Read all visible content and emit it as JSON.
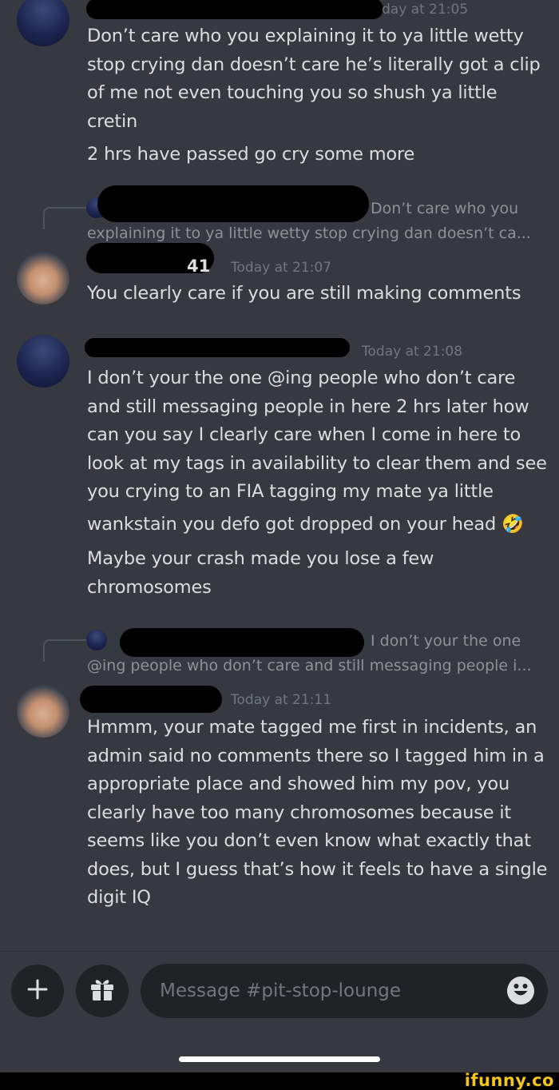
{
  "messages": [
    {
      "timestamp": "day at 21:05",
      "lines": [
        "Don’t care who you explaining it to ya little wetty",
        "stop crying dan doesn’t care he’s literally got a clip",
        "of me not even touching you so shush ya little",
        "cretin"
      ],
      "extra": [
        "2 hrs have passed go cry some more"
      ]
    },
    {
      "reply_preview_line1": "Don’t care who you",
      "reply_preview_line2": "explaining it to ya little wetty stop crying dan doesn’t ca...",
      "author_fragment": "41",
      "timestamp": "Today at 21:07",
      "lines": [
        "You clearly care if you are still making comments"
      ]
    },
    {
      "timestamp": "Today at 21:08",
      "lines": [
        "I don’t your the one @ing people who don’t care",
        "and still messaging people in here 2 hrs later how",
        "can you say I clearly care when I come in here to",
        "look at my tags in availability to clear them and see",
        "you crying to an FIA tagging my mate ya little",
        "wankstain you defo got dropped on your head 🤣"
      ],
      "extra": [
        "Maybe your crash made you lose a few",
        "chromosomes"
      ]
    },
    {
      "reply_preview_line1": "I don’t your the one",
      "reply_preview_line2": "@ing people who don’t care and still messaging people i...",
      "timestamp": "Today at 21:11",
      "lines": [
        "Hmmm, your mate tagged me first in incidents, an",
        "admin said no comments there so I tagged him in a",
        "appropriate place and showed him my pov, you",
        "clearly have too many chromosomes because it",
        "seems like you don’t even know what exactly that",
        "does, but I guess that’s how it feels to have a single",
        "digit IQ"
      ]
    }
  ],
  "composer": {
    "placeholder": "Message #pit-stop-lounge",
    "add_icon": "plus-icon",
    "gift_icon": "gift-icon",
    "emoji_icon": "smiley-icon"
  },
  "watermark": "ifunny.co",
  "colors": {
    "background": "#36393f",
    "text": "#dcddde",
    "muted": "#72767d",
    "input_bg": "#202225",
    "watermark": "#f5c518"
  }
}
